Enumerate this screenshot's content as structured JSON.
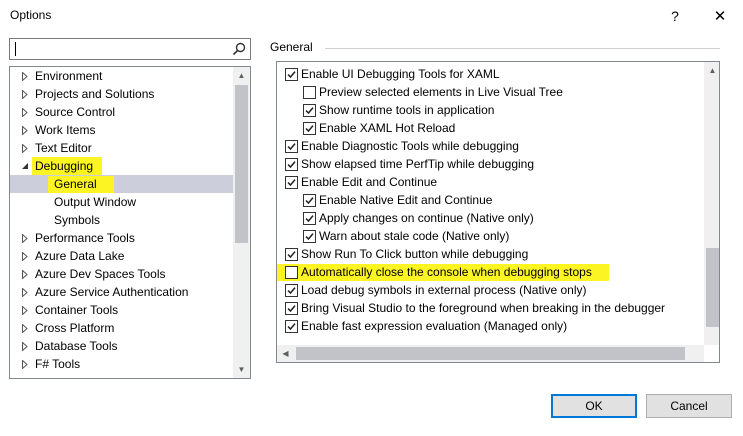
{
  "window": {
    "title": "Options",
    "help_symbol": "?",
    "close_symbol": "✕"
  },
  "search": {
    "value": "",
    "placeholder": ""
  },
  "tree": {
    "items": [
      {
        "label": "Environment",
        "expander": "collapsed",
        "indent": 0
      },
      {
        "label": "Projects and Solutions",
        "expander": "collapsed",
        "indent": 0
      },
      {
        "label": "Source Control",
        "expander": "collapsed",
        "indent": 0
      },
      {
        "label": "Work Items",
        "expander": "collapsed",
        "indent": 0
      },
      {
        "label": "Text Editor",
        "expander": "collapsed",
        "indent": 0
      },
      {
        "label": "Debugging",
        "expander": "expanded",
        "indent": 0,
        "highlighted": true
      },
      {
        "label": "General",
        "expander": "none",
        "indent": 1,
        "selected": true,
        "highlighted": true
      },
      {
        "label": "Output Window",
        "expander": "none",
        "indent": 1
      },
      {
        "label": "Symbols",
        "expander": "none",
        "indent": 1
      },
      {
        "label": "Performance Tools",
        "expander": "collapsed",
        "indent": 0
      },
      {
        "label": "Azure Data Lake",
        "expander": "collapsed",
        "indent": 0
      },
      {
        "label": "Azure Dev Spaces Tools",
        "expander": "collapsed",
        "indent": 0
      },
      {
        "label": "Azure Service Authentication",
        "expander": "collapsed",
        "indent": 0
      },
      {
        "label": "Container Tools",
        "expander": "collapsed",
        "indent": 0
      },
      {
        "label": "Cross Platform",
        "expander": "collapsed",
        "indent": 0
      },
      {
        "label": "Database Tools",
        "expander": "collapsed",
        "indent": 0
      },
      {
        "label": "F# Tools",
        "expander": "collapsed",
        "indent": 0
      }
    ]
  },
  "main": {
    "section_title": "General",
    "options": [
      {
        "label": "Enable UI Debugging Tools for XAML",
        "checked": true,
        "indent": 0
      },
      {
        "label": "Preview selected elements in Live Visual Tree",
        "checked": false,
        "indent": 1
      },
      {
        "label": "Show runtime tools in application",
        "checked": true,
        "indent": 1
      },
      {
        "label": "Enable XAML Hot Reload",
        "checked": true,
        "indent": 1
      },
      {
        "label": "Enable Diagnostic Tools while debugging",
        "checked": true,
        "indent": 0
      },
      {
        "label": "Show elapsed time PerfTip while debugging",
        "checked": true,
        "indent": 0
      },
      {
        "label": "Enable Edit and Continue",
        "checked": true,
        "indent": 0
      },
      {
        "label": "Enable Native Edit and Continue",
        "checked": true,
        "indent": 1
      },
      {
        "label": "Apply changes on continue (Native only)",
        "checked": true,
        "indent": 1
      },
      {
        "label": "Warn about stale code (Native only)",
        "checked": true,
        "indent": 1
      },
      {
        "label": "Show Run To Click button while debugging",
        "checked": true,
        "indent": 0
      },
      {
        "label": "Automatically close the console when debugging stops",
        "checked": false,
        "indent": 0,
        "highlighted": true
      },
      {
        "label": "Load debug symbols in external process (Native only)",
        "checked": true,
        "indent": 0
      },
      {
        "label": "Bring Visual Studio to the foreground when breaking in the debugger",
        "checked": true,
        "indent": 0
      },
      {
        "label": "Enable fast expression evaluation (Managed only)",
        "checked": true,
        "indent": 0
      }
    ]
  },
  "buttons": {
    "ok": "OK",
    "cancel": "Cancel"
  },
  "colors": {
    "highlight": "#fcf523",
    "selection": "#cccedb",
    "default_button_border": "#0078d7"
  }
}
